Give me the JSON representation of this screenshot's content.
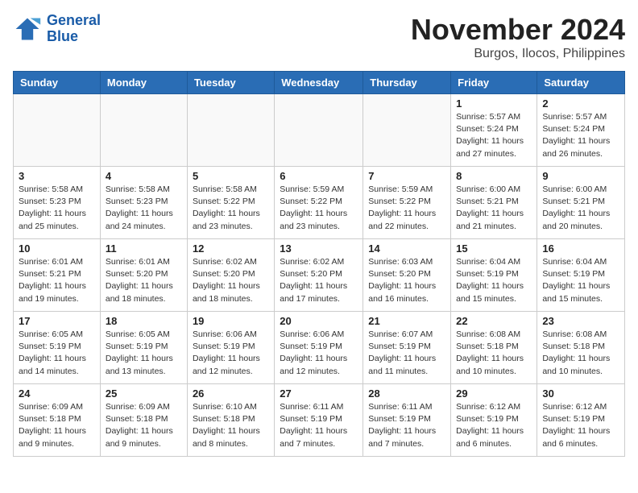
{
  "header": {
    "logo_line1": "General",
    "logo_line2": "Blue",
    "month": "November 2024",
    "location": "Burgos, Ilocos, Philippines"
  },
  "weekdays": [
    "Sunday",
    "Monday",
    "Tuesday",
    "Wednesday",
    "Thursday",
    "Friday",
    "Saturday"
  ],
  "weeks": [
    [
      {
        "day": "",
        "info": ""
      },
      {
        "day": "",
        "info": ""
      },
      {
        "day": "",
        "info": ""
      },
      {
        "day": "",
        "info": ""
      },
      {
        "day": "",
        "info": ""
      },
      {
        "day": "1",
        "info": "Sunrise: 5:57 AM\nSunset: 5:24 PM\nDaylight: 11 hours\nand 27 minutes."
      },
      {
        "day": "2",
        "info": "Sunrise: 5:57 AM\nSunset: 5:24 PM\nDaylight: 11 hours\nand 26 minutes."
      }
    ],
    [
      {
        "day": "3",
        "info": "Sunrise: 5:58 AM\nSunset: 5:23 PM\nDaylight: 11 hours\nand 25 minutes."
      },
      {
        "day": "4",
        "info": "Sunrise: 5:58 AM\nSunset: 5:23 PM\nDaylight: 11 hours\nand 24 minutes."
      },
      {
        "day": "5",
        "info": "Sunrise: 5:58 AM\nSunset: 5:22 PM\nDaylight: 11 hours\nand 23 minutes."
      },
      {
        "day": "6",
        "info": "Sunrise: 5:59 AM\nSunset: 5:22 PM\nDaylight: 11 hours\nand 23 minutes."
      },
      {
        "day": "7",
        "info": "Sunrise: 5:59 AM\nSunset: 5:22 PM\nDaylight: 11 hours\nand 22 minutes."
      },
      {
        "day": "8",
        "info": "Sunrise: 6:00 AM\nSunset: 5:21 PM\nDaylight: 11 hours\nand 21 minutes."
      },
      {
        "day": "9",
        "info": "Sunrise: 6:00 AM\nSunset: 5:21 PM\nDaylight: 11 hours\nand 20 minutes."
      }
    ],
    [
      {
        "day": "10",
        "info": "Sunrise: 6:01 AM\nSunset: 5:21 PM\nDaylight: 11 hours\nand 19 minutes."
      },
      {
        "day": "11",
        "info": "Sunrise: 6:01 AM\nSunset: 5:20 PM\nDaylight: 11 hours\nand 18 minutes."
      },
      {
        "day": "12",
        "info": "Sunrise: 6:02 AM\nSunset: 5:20 PM\nDaylight: 11 hours\nand 18 minutes."
      },
      {
        "day": "13",
        "info": "Sunrise: 6:02 AM\nSunset: 5:20 PM\nDaylight: 11 hours\nand 17 minutes."
      },
      {
        "day": "14",
        "info": "Sunrise: 6:03 AM\nSunset: 5:20 PM\nDaylight: 11 hours\nand 16 minutes."
      },
      {
        "day": "15",
        "info": "Sunrise: 6:04 AM\nSunset: 5:19 PM\nDaylight: 11 hours\nand 15 minutes."
      },
      {
        "day": "16",
        "info": "Sunrise: 6:04 AM\nSunset: 5:19 PM\nDaylight: 11 hours\nand 15 minutes."
      }
    ],
    [
      {
        "day": "17",
        "info": "Sunrise: 6:05 AM\nSunset: 5:19 PM\nDaylight: 11 hours\nand 14 minutes."
      },
      {
        "day": "18",
        "info": "Sunrise: 6:05 AM\nSunset: 5:19 PM\nDaylight: 11 hours\nand 13 minutes."
      },
      {
        "day": "19",
        "info": "Sunrise: 6:06 AM\nSunset: 5:19 PM\nDaylight: 11 hours\nand 12 minutes."
      },
      {
        "day": "20",
        "info": "Sunrise: 6:06 AM\nSunset: 5:19 PM\nDaylight: 11 hours\nand 12 minutes."
      },
      {
        "day": "21",
        "info": "Sunrise: 6:07 AM\nSunset: 5:19 PM\nDaylight: 11 hours\nand 11 minutes."
      },
      {
        "day": "22",
        "info": "Sunrise: 6:08 AM\nSunset: 5:18 PM\nDaylight: 11 hours\nand 10 minutes."
      },
      {
        "day": "23",
        "info": "Sunrise: 6:08 AM\nSunset: 5:18 PM\nDaylight: 11 hours\nand 10 minutes."
      }
    ],
    [
      {
        "day": "24",
        "info": "Sunrise: 6:09 AM\nSunset: 5:18 PM\nDaylight: 11 hours\nand 9 minutes."
      },
      {
        "day": "25",
        "info": "Sunrise: 6:09 AM\nSunset: 5:18 PM\nDaylight: 11 hours\nand 9 minutes."
      },
      {
        "day": "26",
        "info": "Sunrise: 6:10 AM\nSunset: 5:18 PM\nDaylight: 11 hours\nand 8 minutes."
      },
      {
        "day": "27",
        "info": "Sunrise: 6:11 AM\nSunset: 5:19 PM\nDaylight: 11 hours\nand 7 minutes."
      },
      {
        "day": "28",
        "info": "Sunrise: 6:11 AM\nSunset: 5:19 PM\nDaylight: 11 hours\nand 7 minutes."
      },
      {
        "day": "29",
        "info": "Sunrise: 6:12 AM\nSunset: 5:19 PM\nDaylight: 11 hours\nand 6 minutes."
      },
      {
        "day": "30",
        "info": "Sunrise: 6:12 AM\nSunset: 5:19 PM\nDaylight: 11 hours\nand 6 minutes."
      }
    ]
  ]
}
